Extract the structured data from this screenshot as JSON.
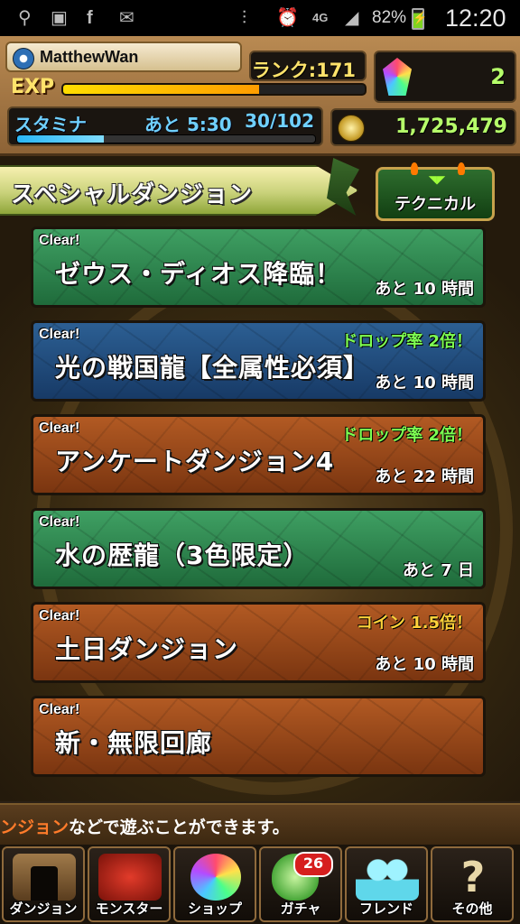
{
  "status_bar": {
    "battery": "82%",
    "network": "4G",
    "time": "12:20",
    "icons": [
      "usb-icon",
      "image-icon",
      "facebook-icon",
      "mail-icon",
      "vibrate-icon",
      "alarm-icon",
      "signal-icon",
      "battery-icon"
    ]
  },
  "player": {
    "name": "MatthewWan",
    "rank_label": "ランク:171",
    "exp_label": "EXP",
    "exp_progress": 0.65,
    "stamina_label": "スタミナ",
    "stamina_time": "あと 5:30",
    "stamina_value": "30/102",
    "stamina_progress": 0.29,
    "magic_stones": "2",
    "coins": "1,725,479"
  },
  "section": {
    "title": "スペシャルダンジョン",
    "technical_button": "テクニカル"
  },
  "dungeons": [
    {
      "clear": "Clear!",
      "name": "ゼウス・ディオス降臨！",
      "bonus": "",
      "remaining": "あと 10 時間",
      "theme": "green"
    },
    {
      "clear": "Clear!",
      "name": "光の戦国龍【全属性必須】",
      "bonus": "ドロップ率 2倍！",
      "remaining": "あと 10 時間",
      "theme": "blue"
    },
    {
      "clear": "Clear!",
      "name": "アンケートダンジョン4",
      "bonus": "ドロップ率 2倍！",
      "remaining": "あと 22 時間",
      "theme": "orange"
    },
    {
      "clear": "Clear!",
      "name": "水の歴龍（3色限定）",
      "bonus": "",
      "remaining": "あと 7 日",
      "theme": "green"
    },
    {
      "clear": "Clear!",
      "name": "土日ダンジョン",
      "bonus": "コイン 1.5倍！",
      "remaining": "あと 10 時間",
      "theme": "orange"
    },
    {
      "clear": "Clear!",
      "name": "新・無限回廊",
      "bonus": "",
      "remaining": "",
      "theme": "orange"
    }
  ],
  "ticker": {
    "highlight": "ンジョン",
    "text": "などで遊ぶことができます。"
  },
  "nav": [
    {
      "label": "ダンジョン",
      "icon": "dungeon-gate-icon"
    },
    {
      "label": "モンスター",
      "icon": "monster-icon"
    },
    {
      "label": "ショップ",
      "icon": "gem-shop-icon"
    },
    {
      "label": "ガチャ",
      "icon": "egg-gacha-icon",
      "badge": "26"
    },
    {
      "label": "フレンド",
      "icon": "friends-icon"
    },
    {
      "label": "その他",
      "icon": "question-icon"
    }
  ],
  "colors": {
    "bonus_green": "#7dff52",
    "bonus_coin": "#ffd23a",
    "stat_green": "#b6ff6a",
    "stamina_blue": "#6fd0ff"
  }
}
